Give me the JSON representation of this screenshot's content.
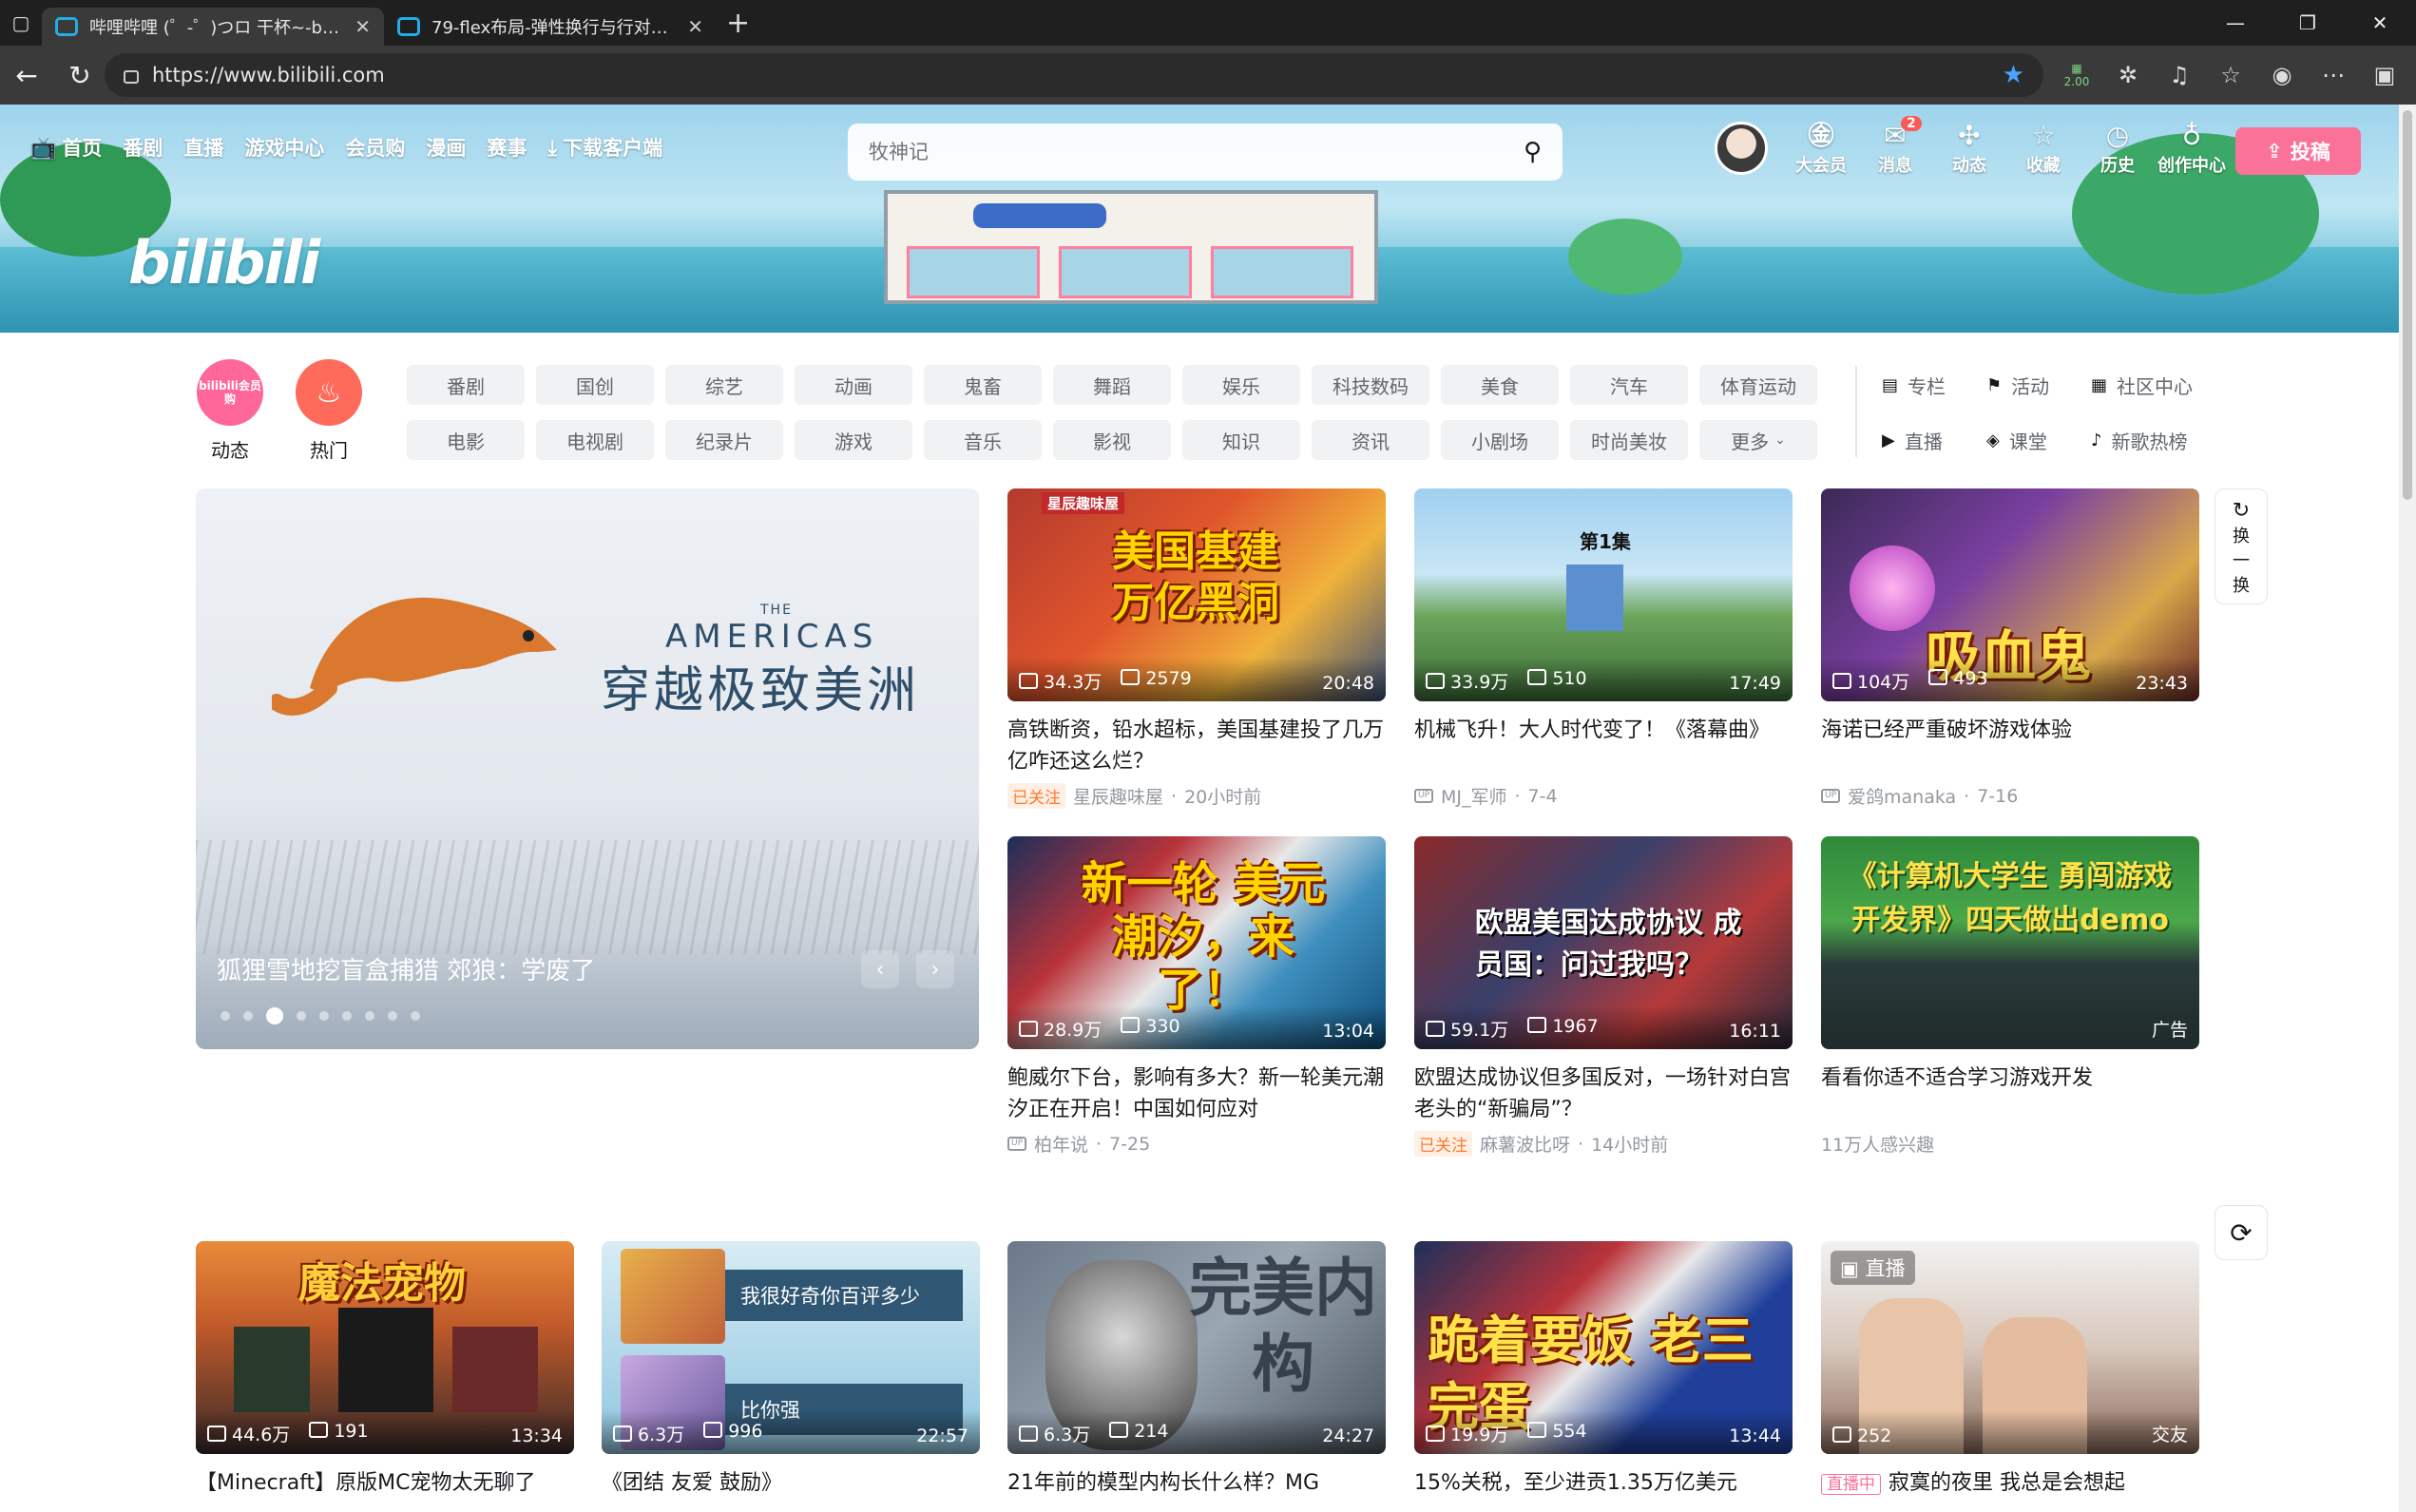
{
  "browser": {
    "tabs": [
      {
        "title": "哔哩哔哩 (゜-゜)つロ 干杯~-bilibili",
        "active": true
      },
      {
        "title": "79-flex布局-弹性换行与行对齐方式",
        "active": false
      }
    ],
    "url": "https://www.bilibili.com",
    "extension_badge": "2.00"
  },
  "header": {
    "logo": "bilibili",
    "nav": [
      {
        "label": "首页",
        "icon": "tv-icon"
      },
      {
        "label": "番剧"
      },
      {
        "label": "直播"
      },
      {
        "label": "游戏中心"
      },
      {
        "label": "会员购"
      },
      {
        "label": "漫画"
      },
      {
        "label": "赛事"
      },
      {
        "label": "下载客户端",
        "icon": "download-icon"
      }
    ],
    "search_placeholder": "牧神记",
    "right_icons": [
      {
        "label": "大会员",
        "icon": "vip-icon"
      },
      {
        "label": "消息",
        "icon": "message-icon",
        "badge": "2"
      },
      {
        "label": "动态",
        "icon": "dynamic-icon"
      },
      {
        "label": "收藏",
        "icon": "favorite-icon"
      },
      {
        "label": "历史",
        "icon": "history-icon"
      },
      {
        "label": "创作中心",
        "icon": "creator-icon"
      }
    ],
    "upload_label": "投稿"
  },
  "channels": {
    "circles": [
      {
        "label": "动态",
        "badge_text": "bilibili会员购",
        "color": "#ff6699"
      },
      {
        "label": "热门",
        "color": "#ff6b5b"
      }
    ],
    "chips": [
      "番剧",
      "国创",
      "综艺",
      "动画",
      "鬼畜",
      "舞蹈",
      "娱乐",
      "科技数码",
      "美食",
      "汽车",
      "体育运动",
      "电影",
      "电视剧",
      "纪录片",
      "游戏",
      "音乐",
      "影视",
      "知识",
      "资讯",
      "小剧场",
      "时尚美妆",
      "更多"
    ],
    "links": [
      {
        "label": "专栏",
        "icon": "article-icon"
      },
      {
        "label": "活动",
        "icon": "flag-icon"
      },
      {
        "label": "社区中心",
        "icon": "community-icon"
      },
      {
        "label": "直播",
        "icon": "live-icon"
      },
      {
        "label": "课堂",
        "icon": "class-icon"
      },
      {
        "label": "新歌热榜",
        "icon": "music-chart-icon"
      }
    ]
  },
  "carousel": {
    "brand_small": "THE",
    "brand": "AMERICAS",
    "brand_cn": "穿越极致美洲",
    "title": "狐狸雪地挖盲盒捕猎 郊狼：学废了",
    "active_index": 2,
    "dot_count": 9
  },
  "refresh": {
    "label_1": "换",
    "label_2": "一",
    "label_3": "换"
  },
  "videos": [
    {
      "views": "34.3万",
      "danmaku": "2579",
      "duration": "20:48",
      "title": "高铁断资，铅水超标，美国基建投了几万亿咋还这么烂？",
      "followed": "已关注",
      "author": "星辰趣味屋",
      "date": "20小时前",
      "overlay": "美国基建 万亿黑洞",
      "tag": "星辰趣味屋"
    },
    {
      "views": "33.9万",
      "danmaku": "510",
      "duration": "17:49",
      "title": "机械飞升！大人时代变了！《落幕曲》",
      "author": "MJ_军师",
      "date": "7-4",
      "overlay": "第1集"
    },
    {
      "views": "104万",
      "danmaku": "493",
      "duration": "23:43",
      "title": "海诺已经严重破坏游戏体验",
      "author": "爱鸽manaka",
      "date": "7-16",
      "overlay": "吸血鬼"
    },
    {
      "views": "28.9万",
      "danmaku": "330",
      "duration": "13:04",
      "title": "鲍威尔下台，影响有多大？新一轮美元潮汐正在开启！中国如何应对",
      "author": "柏年说",
      "date": "7-25",
      "overlay": "新一轮 美元潮汐，来了！"
    },
    {
      "views": "59.1万",
      "danmaku": "1967",
      "duration": "16:11",
      "title": "欧盟达成协议但多国反对，一场针对白宫老头的“新骗局”？",
      "followed": "已关注",
      "author": "麻薯波比呀",
      "date": "14小时前",
      "overlay": "欧盟美国达成协议 成员国：问过我吗？"
    },
    {
      "title": "看看你适不适合学习游戏开发",
      "ad": "广告",
      "interest": "11万人感兴趣",
      "overlay": "《计算机大学生 勇闯游戏开发界》四天做出demo"
    },
    {
      "views": "44.6万",
      "danmaku": "191",
      "duration": "13:34",
      "title": "【Minecraft】原版MC宠物太无聊了",
      "overlay": "魔法宠物"
    },
    {
      "views": "6.3万",
      "danmaku": "996",
      "duration": "22:57",
      "title": "《团结 友爱 鼓励》",
      "overlay_1": "我很好奇你百评多少",
      "overlay_2": "比你强"
    },
    {
      "views": "6.3万",
      "danmaku": "214",
      "duration": "24:27",
      "title": "21年前的模型内构长什么样？MG",
      "overlay": "完美内构"
    },
    {
      "views": "19.9万",
      "danmaku": "554",
      "duration": "13:44",
      "title": "15%关税，至少进贡1.35万亿美元",
      "overlay": "跪着要饭 老三完蛋"
    },
    {
      "live_label": "直播",
      "viewers": "252",
      "category": "交友",
      "live_pill": "直播中",
      "title": "寂寞的夜里 我总是会想起"
    }
  ]
}
